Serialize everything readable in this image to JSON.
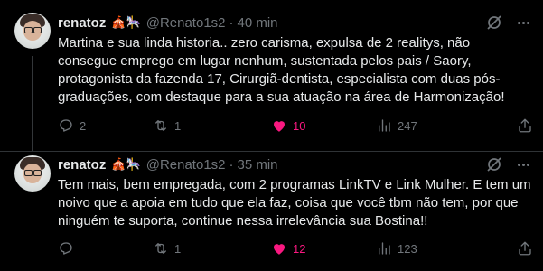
{
  "tweets": [
    {
      "name": "renatoz",
      "emoji": "🎪🎠",
      "handle": "@Renato1s2",
      "separator": "·",
      "time": "40 min",
      "text": "Martina e sua linda historia.. zero carisma, expulsa de 2 realitys, não consegue emprego em lugar nenhum, sustentada pelos pais / Saory, protagonista da fazenda 17, Cirurgiã-dentista, especialista com duas pós-graduações, com destaque para a sua atuação na área de Harmonização!",
      "replies": "2",
      "retweets": "1",
      "likes": "10",
      "views": "247",
      "liked": true
    },
    {
      "name": "renatoz",
      "emoji": "🎪🎠",
      "handle": "@Renato1s2",
      "separator": "·",
      "time": "35 min",
      "text": "Tem mais, bem empregada, com 2 programas LinkTV e Link Mulher. E tem um noivo que a apoia em tudo que ela faz, coisa que você tbm não tem, por que ninguém te suporta, continue nessa irrelevância sua Bostina!!",
      "replies": "",
      "retweets": "1",
      "likes": "12",
      "views": "123",
      "liked": true
    }
  ],
  "colors": {
    "background": "#000000",
    "text": "#e7e9ea",
    "secondary": "#71767b",
    "like": "#f91880",
    "divider": "#2f3336"
  },
  "icons": [
    "reply-icon",
    "retweet-icon",
    "heart-icon",
    "views-icon",
    "share-icon",
    "hide-icon",
    "more-icon"
  ]
}
